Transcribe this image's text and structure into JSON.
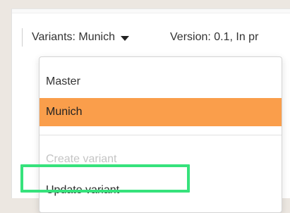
{
  "toolbar": {
    "variants_label": "Variants: Munich",
    "version_label": "Version: 0.1, In pr"
  },
  "menu": {
    "items": [
      {
        "label": "Master",
        "state": "normal"
      },
      {
        "label": "Munich",
        "state": "selected"
      },
      {
        "label": "Create variant",
        "state": "disabled"
      },
      {
        "label": "Update variant",
        "state": "highlighted"
      }
    ]
  },
  "colors": {
    "selected_bg": "#fa9e4b",
    "highlight_border": "#36e27c",
    "disabled_text": "#c4c4c4"
  }
}
